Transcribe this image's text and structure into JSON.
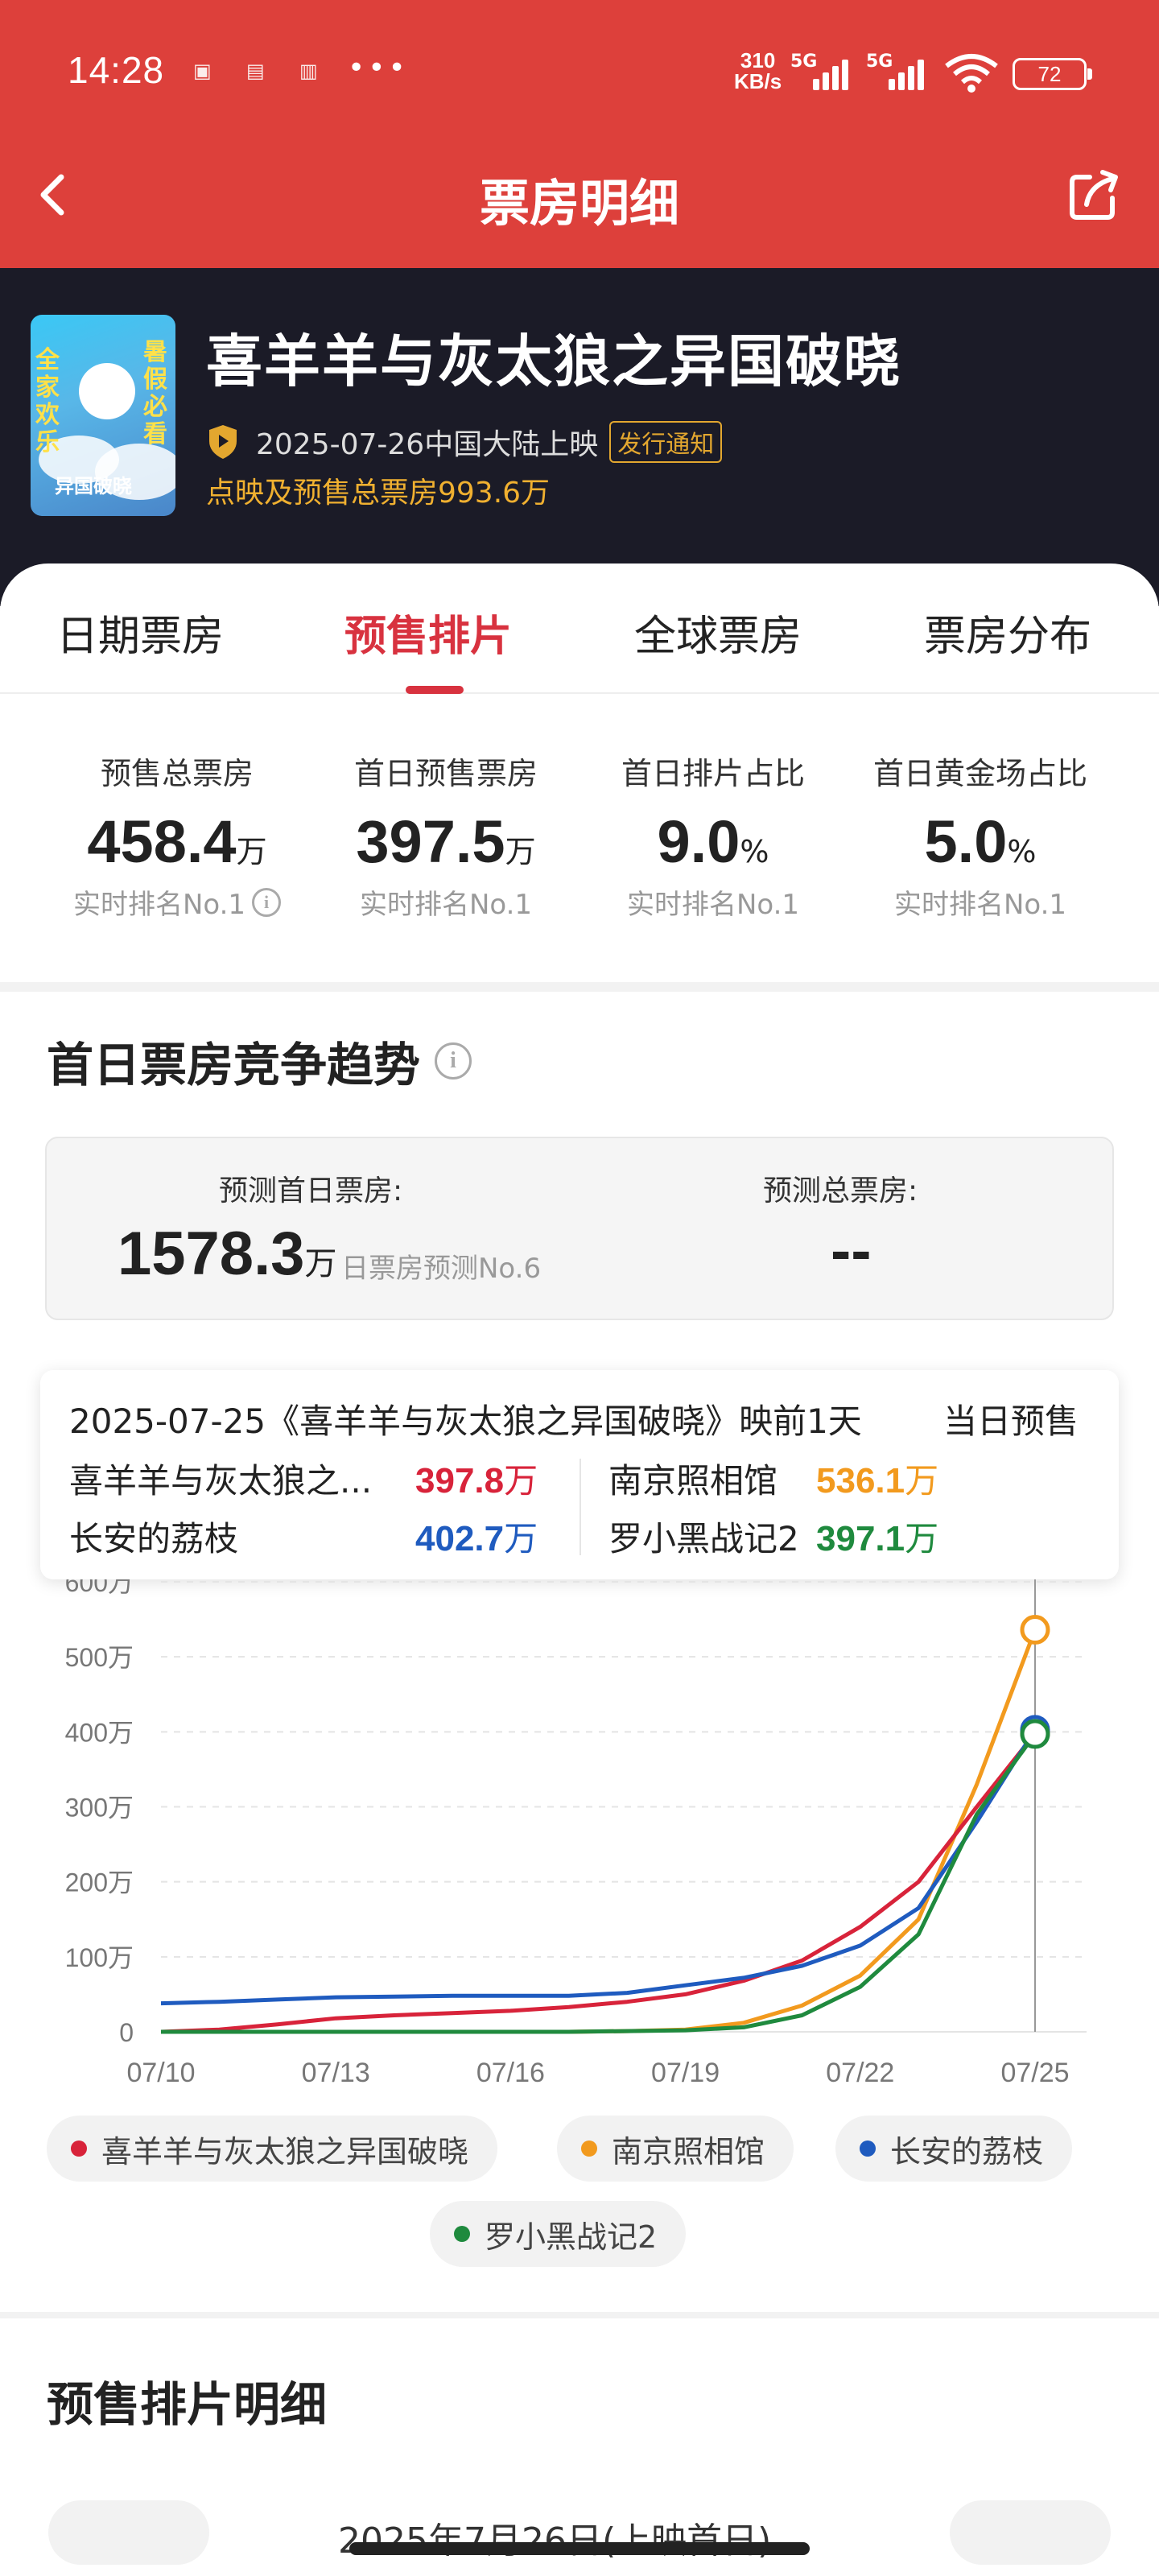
{
  "status_bar": {
    "time": "14:28",
    "network_speed_value": "310",
    "network_speed_unit": "KB/s",
    "signal1_label": "5G",
    "signal2_label": "5G",
    "battery": "72"
  },
  "nav": {
    "title": "票房明细"
  },
  "movie": {
    "title": "喜羊羊与灰太狼之异国破晓",
    "release": "2025-07-26中国大陆上映",
    "notice_badge": "发行通知",
    "presale_total": "点映及预售总票房993.6万",
    "poster_text_left": "全家欢乐",
    "poster_text_right": "暑假必看",
    "poster_logo": "异国破晓"
  },
  "tabs": [
    {
      "label": "日期票房",
      "active": false
    },
    {
      "label": "预售排片",
      "active": true
    },
    {
      "label": "全球票房",
      "active": false
    },
    {
      "label": "票房分布",
      "active": false
    }
  ],
  "stats": [
    {
      "label": "预售总票房",
      "value": "458.4",
      "unit": "万",
      "rank": "实时排名No.1"
    },
    {
      "label": "首日预售票房",
      "value": "397.5",
      "unit": "万",
      "rank": "实时排名No.1"
    },
    {
      "label": "首日排片占比",
      "value": "9.0",
      "unit": "%",
      "rank": "实时排名No.1"
    },
    {
      "label": "首日黄金场占比",
      "value": "5.0",
      "unit": "%",
      "rank": "实时排名No.1"
    }
  ],
  "trend": {
    "title": "首日票房竞争趋势",
    "predict_first_day_label": "预测首日票房:",
    "predict_first_day_value": "1578.3",
    "predict_first_day_unit": "万",
    "predict_first_day_rank": "日票房预测No.6",
    "predict_total_label": "预测总票房:",
    "predict_total_value": "--"
  },
  "tooltip": {
    "header": "2025-07-25《喜羊羊与灰太狼之异国破晓》映前1天",
    "header_tail": "当日预售",
    "rows": [
      {
        "name": "喜羊羊与灰太狼之...",
        "value": "397.8",
        "unit": "万",
        "color": "#d8233a"
      },
      {
        "name": "南京照相馆",
        "value": "536.1",
        "unit": "万",
        "color": "#f29a1e"
      },
      {
        "name": "长安的荔枝",
        "value": "402.7",
        "unit": "万",
        "color": "#1f5bbf"
      },
      {
        "name": "罗小黑战记2",
        "value": "397.1",
        "unit": "万",
        "color": "#1f8a3e"
      }
    ]
  },
  "chart_data": {
    "type": "line",
    "x": [
      "07/10",
      "07/11",
      "07/12",
      "07/13",
      "07/14",
      "07/15",
      "07/16",
      "07/17",
      "07/18",
      "07/19",
      "07/20",
      "07/21",
      "07/22",
      "07/23",
      "07/24",
      "07/25"
    ],
    "x_tick_labels": [
      "07/10",
      "07/13",
      "07/16",
      "07/19",
      "07/22",
      "07/25"
    ],
    "y_tick_labels": [
      "0",
      "100万",
      "200万",
      "300万",
      "400万",
      "500万",
      "600万"
    ],
    "ylim": [
      0,
      600
    ],
    "y_unit": "万",
    "series": [
      {
        "name": "喜羊羊与灰太狼之异国破晓",
        "color": "#d8233a",
        "values": [
          0,
          3,
          10,
          18,
          22,
          25,
          28,
          33,
          40,
          50,
          68,
          95,
          140,
          200,
          300,
          397.8
        ]
      },
      {
        "name": "南京照相馆",
        "color": "#f29a1e",
        "values": [
          0,
          0,
          0,
          0,
          0,
          0,
          0,
          0,
          1,
          3,
          12,
          35,
          75,
          150,
          330,
          536.1
        ]
      },
      {
        "name": "长安的荔枝",
        "color": "#1f5bbf",
        "values": [
          38,
          40,
          43,
          46,
          47,
          48,
          48,
          48,
          52,
          62,
          72,
          88,
          115,
          165,
          280,
          402.7
        ]
      },
      {
        "name": "罗小黑战记2",
        "color": "#1f8a3e",
        "values": [
          0,
          0,
          0,
          0,
          0,
          0,
          0,
          0,
          1,
          2,
          6,
          22,
          60,
          130,
          290,
          397.1
        ]
      }
    ],
    "highlight_x": "07/25",
    "grid": true
  },
  "detail": {
    "title": "预售排片明细",
    "date_partial": "2025年7月26日(上映首日)"
  }
}
